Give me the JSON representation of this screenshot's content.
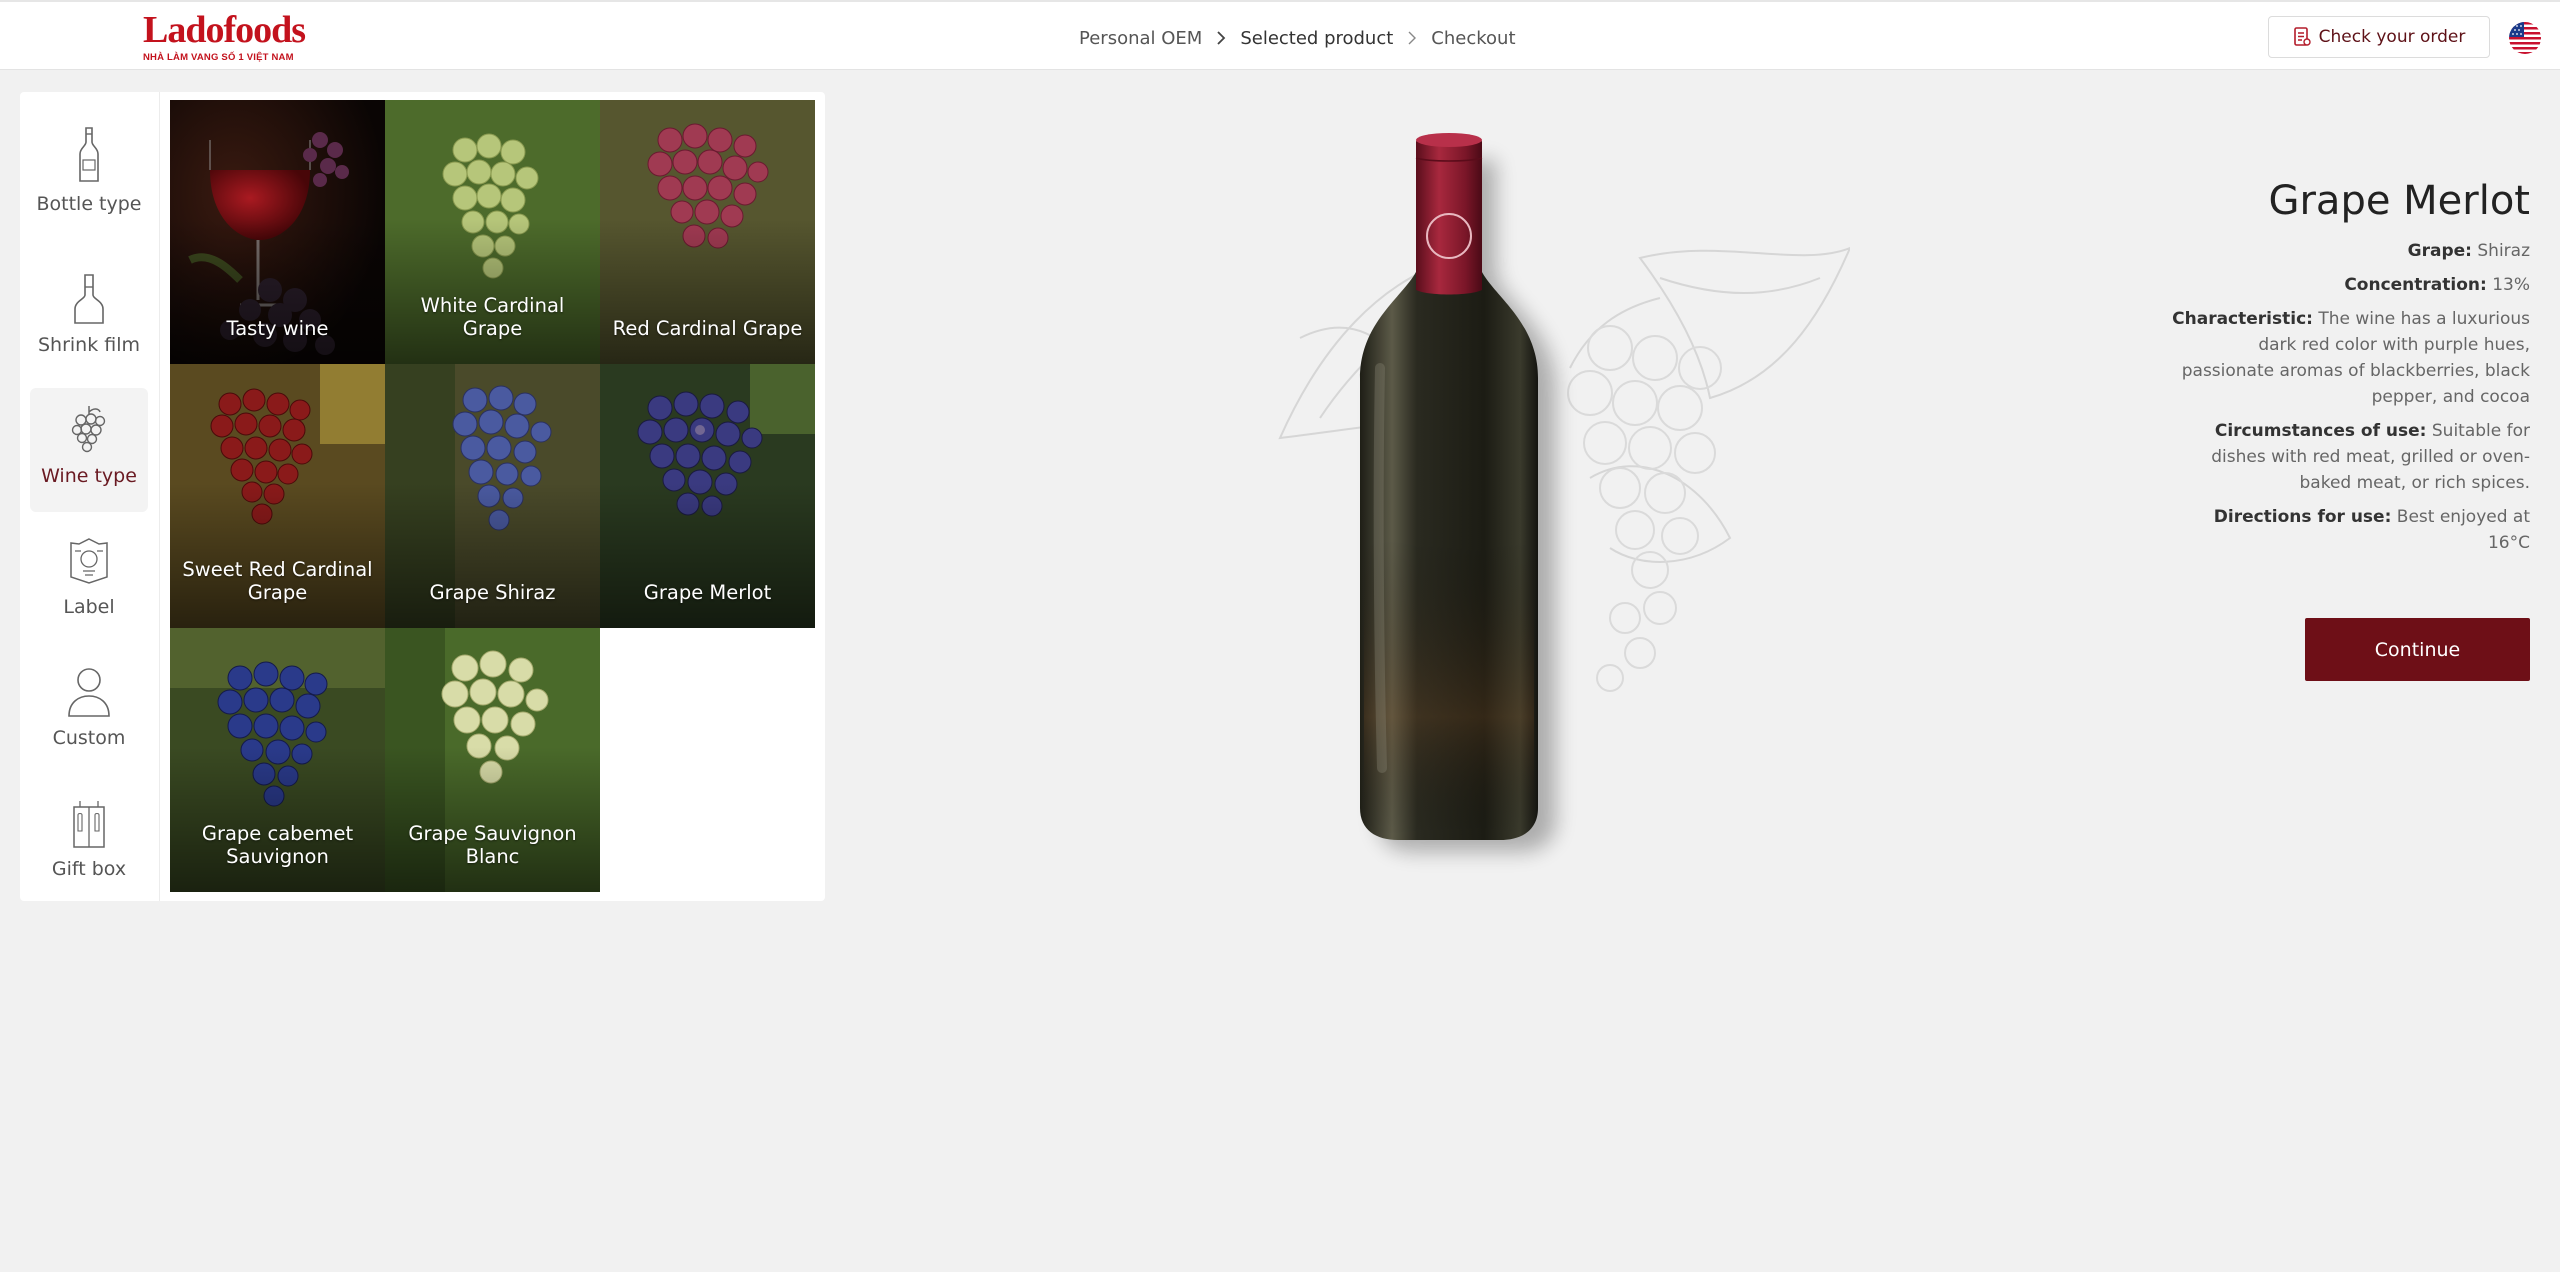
{
  "header": {
    "logo_text": "Ladofoods",
    "logo_tagline": "NHÀ LÀM VANG SỐ 1 VIỆT NAM",
    "breadcrumb": [
      "Personal OEM",
      "Selected product",
      "Checkout"
    ],
    "check_order_label": "Check your order",
    "language": "en-US"
  },
  "sidebar": {
    "items": [
      {
        "label": "Bottle type",
        "icon": "bottle-icon"
      },
      {
        "label": "Shrink film",
        "icon": "shrink-film-icon"
      },
      {
        "label": "Wine type",
        "icon": "grape-icon",
        "active": true
      },
      {
        "label": "Label",
        "icon": "label-icon"
      },
      {
        "label": "Custom",
        "icon": "user-icon"
      },
      {
        "label": "Gift box",
        "icon": "gift-box-icon"
      }
    ]
  },
  "wine_types": [
    {
      "label": "Tasty wine"
    },
    {
      "label": "White Cardinal Grape"
    },
    {
      "label": "Red Cardinal Grape"
    },
    {
      "label": "Sweet Red Cardinal Grape"
    },
    {
      "label": "Grape Shiraz"
    },
    {
      "label": "Grape Merlot",
      "selected": true
    },
    {
      "label": "Grape cabemet Sauvignon"
    },
    {
      "label": "Grape Sauvignon Blanc"
    }
  ],
  "product": {
    "title": "Grape Merlot",
    "grape_label": "Grape:",
    "grape_value": "Shiraz",
    "concentration_label": "Concentration:",
    "concentration_value": "13%",
    "characteristic_label": "Characteristic:",
    "characteristic_value": "The wine has a luxurious dark red color with purple hues, passionate aromas of blackberries, black pepper, and cocoa",
    "circumstances_label": "Circumstances of use:",
    "circumstances_value": "Suitable for dishes with red meat, grilled or oven-baked meat, or rich spices.",
    "directions_label": "Directions for use:",
    "directions_value": "Best enjoyed at 16°C",
    "continue_label": "Continue"
  },
  "colors": {
    "brand_red": "#c3121d",
    "accent_wine": "#6e0f17",
    "capsule": "#8a1a2e"
  }
}
